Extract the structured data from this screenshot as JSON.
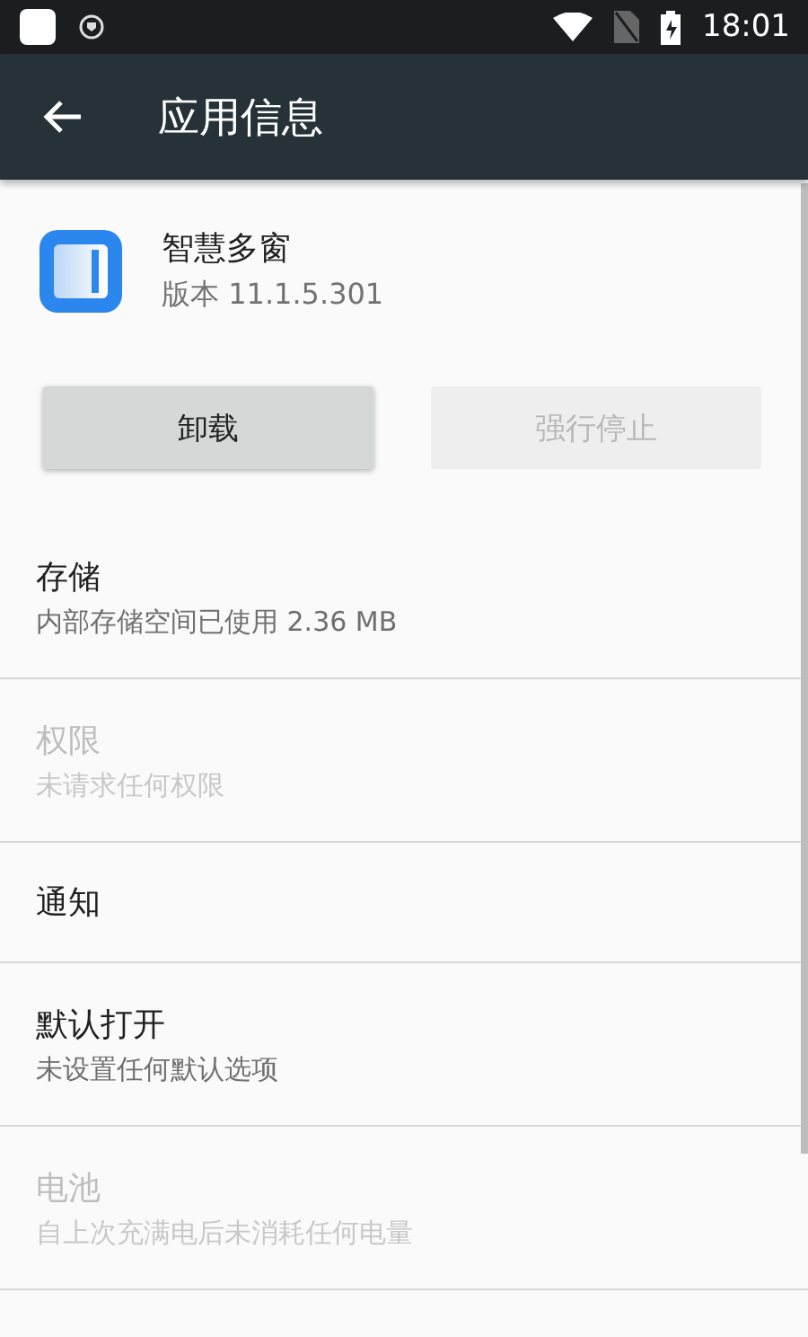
{
  "status_bar": {
    "time": "18:01"
  },
  "toolbar": {
    "title": "应用信息"
  },
  "app": {
    "name": "智慧多窗",
    "version": "版本 11.1.5.301"
  },
  "buttons": [
    {
      "label": "卸载",
      "disabled": false
    },
    {
      "label": "强行停止",
      "disabled": true
    }
  ],
  "items": [
    {
      "title": "存储",
      "summary": "内部存储空间已使用 2.36 MB",
      "disabled": false
    },
    {
      "title": "权限",
      "summary": "未请求任何权限",
      "disabled": true
    },
    {
      "title": "通知",
      "disabled": false
    },
    {
      "title": "默认打开",
      "summary": "未设置任何默认选项",
      "disabled": false
    },
    {
      "title": "电池",
      "summary": "自上次充满电后未消耗任何电量",
      "disabled": true
    }
  ]
}
